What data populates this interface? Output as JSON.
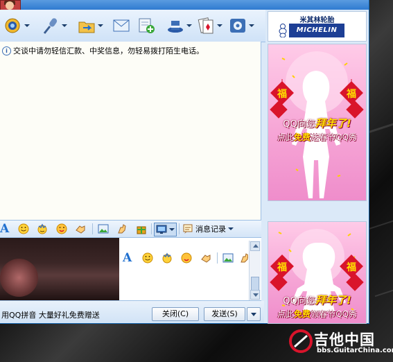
{
  "toolbar": {
    "buttons": [
      {
        "icon": "video-call-icon",
        "has_menu": true
      },
      {
        "icon": "microphone-icon",
        "has_menu": true
      },
      {
        "icon": "folder-transfer-icon",
        "has_menu": true
      },
      {
        "icon": "email-icon",
        "has_menu": false
      },
      {
        "icon": "add-contact-icon",
        "has_menu": false
      },
      {
        "icon": "app-hat-icon",
        "has_menu": true
      },
      {
        "icon": "game-cards-icon",
        "has_menu": true
      },
      {
        "icon": "settings-gear-icon",
        "has_menu": true
      }
    ]
  },
  "ad_top": {
    "brand_cn": "米其林轮胎",
    "brand_en": "MICHELIN"
  },
  "chat": {
    "notice": "交谈中请勿轻信汇款、中奖信息，勿轻易拨打陌生电话。"
  },
  "format_bar": {
    "font_label": "A",
    "history_label": "消息记录"
  },
  "inner_format": {
    "font_label": "A"
  },
  "bottom": {
    "promo": "用QQ拼音 大量好礼免费赠送",
    "close_label": "关闭(C)",
    "send_label": "发送(S)"
  },
  "ad_panel_1": {
    "fu_char": "福",
    "line1_prefix": "QQ向您",
    "line1_highlight": "拜年了!",
    "line2_pre": "点此",
    "line2_highlight": "免费",
    "line2_post": "送春节QQ秀"
  },
  "ad_panel_2": {
    "fu_char": "福",
    "line1_prefix": "QQ向您",
    "line1_highlight": "拜年了!",
    "line2_pre": "点此",
    "line2_highlight": "免费",
    "line2_post": "领春节QQ秀"
  },
  "watermark": {
    "title": "吉他中国",
    "url": "bbs.GuitarChina.com"
  },
  "colors": {
    "window_bg": "#dbe9f8",
    "toolbar_blue": "#1f6fcf",
    "ad_pink": "#f6a6d6",
    "fu_red": "#d9142b",
    "highlight_yellow": "#ffe000"
  }
}
